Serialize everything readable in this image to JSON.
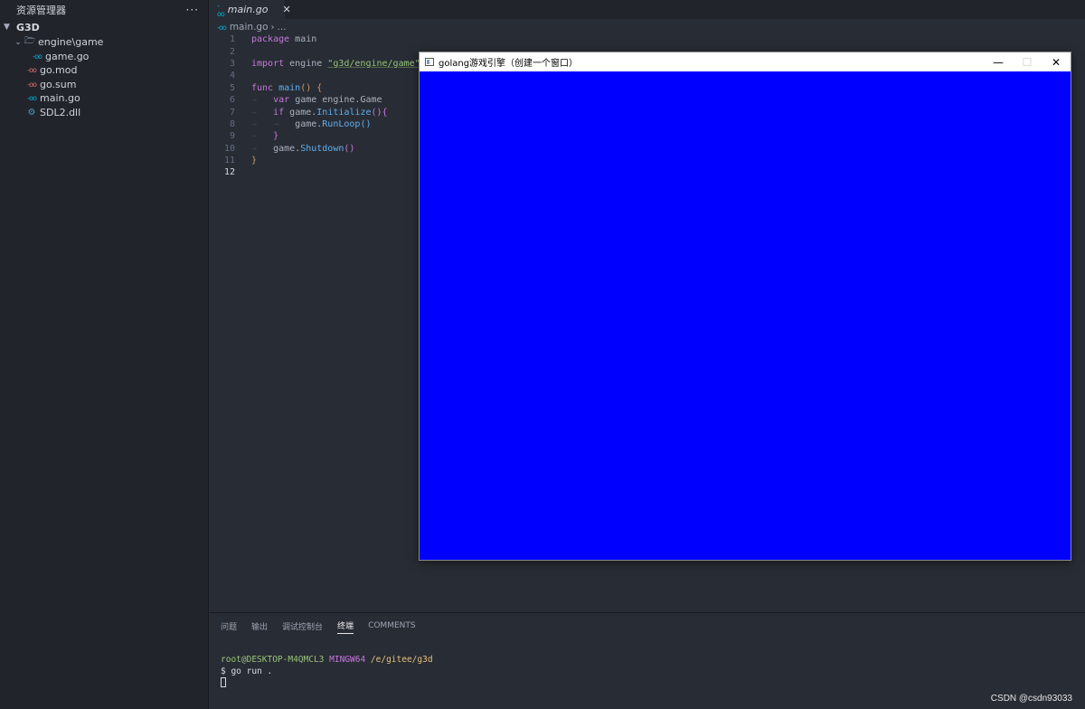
{
  "sidebar": {
    "title": "资源管理器",
    "more": "···",
    "section": "G3D",
    "items": [
      {
        "label": "engine\\game",
        "type": "folder",
        "expanded": true,
        "icon": "folder-open-icon"
      },
      {
        "label": "game.go",
        "type": "go",
        "icon": "go-file-icon"
      },
      {
        "label": "go.mod",
        "type": "gomod",
        "icon": "go-mod-icon"
      },
      {
        "label": "go.sum",
        "type": "gomod",
        "icon": "go-sum-icon"
      },
      {
        "label": "main.go",
        "type": "go",
        "icon": "go-file-icon"
      },
      {
        "label": "SDL2.dll",
        "type": "dll",
        "icon": "gear-icon"
      }
    ]
  },
  "tabs": [
    {
      "label": "main.go",
      "icon": "go-file-icon",
      "active": true
    }
  ],
  "breadcrumb": {
    "file": "main.go",
    "rest": "..."
  },
  "code": {
    "lines": [
      "package main",
      "",
      "import engine \"g3d/engine/game\"",
      "",
      "func main() {",
      "    var game engine.Game",
      "    if game.Initialize(){",
      "        game.RunLoop()",
      "    }",
      "    game.Shutdown()",
      "}",
      ""
    ],
    "active_line": 12
  },
  "panel": {
    "tabs": [
      "问题",
      "输出",
      "调试控制台",
      "终端",
      "COMMENTS"
    ],
    "active_tab": "终端",
    "terminal": {
      "user": "root@DESKTOP-M4QMCL3",
      "shell": "MINGW64",
      "path": "/e/gitee/g3d",
      "command": "$ go run ."
    }
  },
  "window": {
    "title": "golang游戏引擎（创建一个窗口）",
    "minimize": "—",
    "maximize": "☐",
    "close": "✕",
    "canvas_color": "#0000ff"
  },
  "watermark": "CSDN @csdn93033",
  "colors": {
    "accent_go": "#00add8",
    "gomod": "#e06c75",
    "editor_bg": "#282c34",
    "sidebar_bg": "#21252b"
  }
}
